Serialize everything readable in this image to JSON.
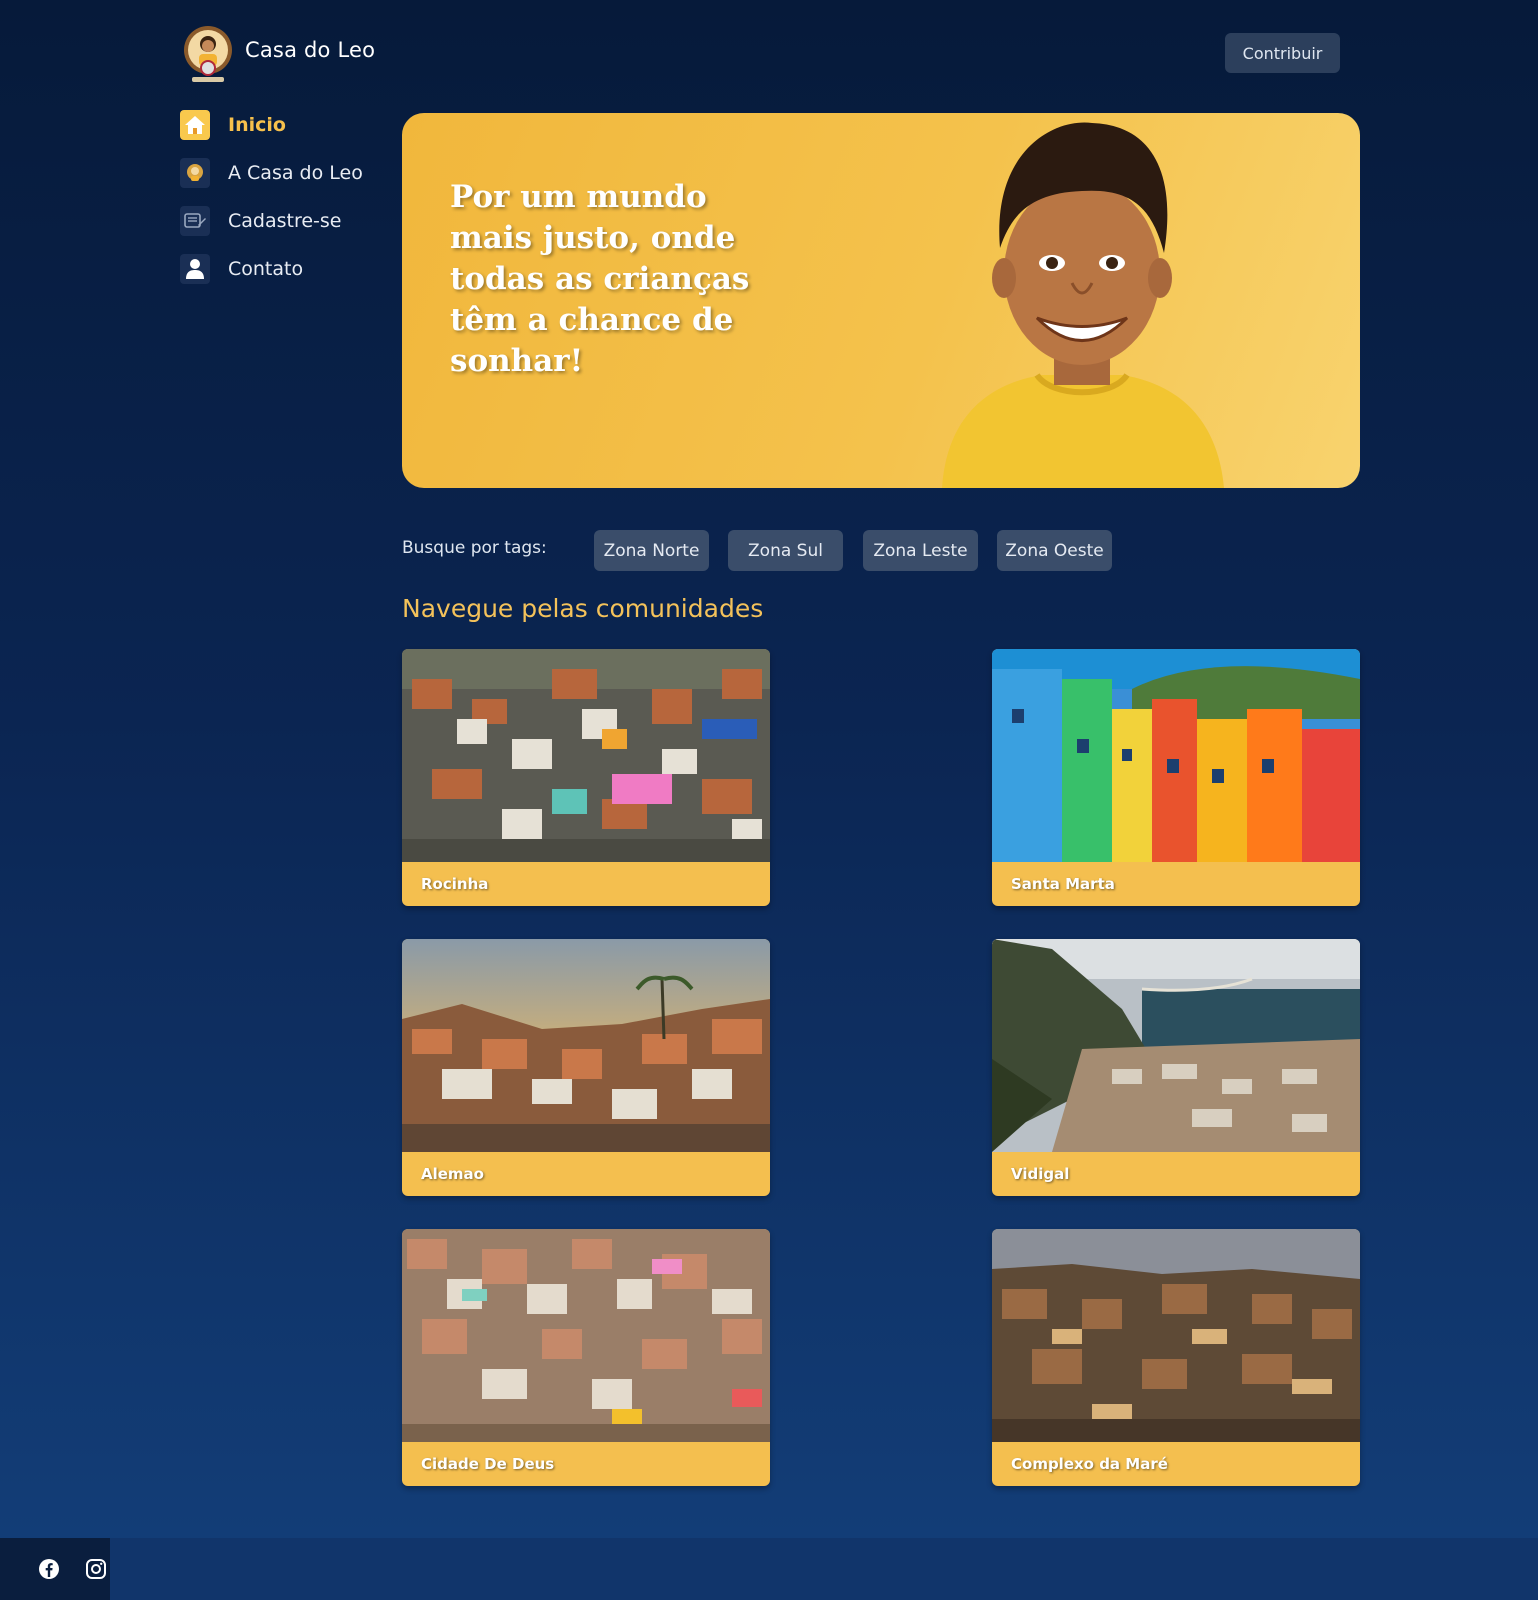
{
  "header": {
    "brand": "Casa do Leo",
    "contribute_label": "Contribuir"
  },
  "sidebar": {
    "items": [
      {
        "label": "Inicio",
        "icon": "home-icon",
        "active": true
      },
      {
        "label": "A Casa do Leo",
        "icon": "leo-logo-icon",
        "active": false
      },
      {
        "label": "Cadastre-se",
        "icon": "register-icon",
        "active": false
      },
      {
        "label": "Contato",
        "icon": "user-icon",
        "active": false
      }
    ]
  },
  "hero": {
    "headline": "Por um mundo mais justo, onde todas as crianças têm a chance de sonhar!"
  },
  "tags": {
    "label": "Busque por tags:",
    "items": [
      "Zona Norte",
      "Zona Sul",
      "Zona Leste",
      "Zona Oeste"
    ]
  },
  "communities": {
    "title": "Navegue pelas comunidades",
    "items": [
      {
        "name": "Rocinha"
      },
      {
        "name": "Santa Marta"
      },
      {
        "name": "Alemao"
      },
      {
        "name": "Vidigal"
      },
      {
        "name": "Cidade De Deus"
      },
      {
        "name": "Complexo da Maré"
      }
    ]
  },
  "footer": {
    "icons": [
      "facebook-icon",
      "instagram-icon"
    ]
  },
  "colors": {
    "accent": "#f4c25a",
    "card": "#f4bf4f",
    "background_top": "#061a3a",
    "background_bottom": "#133f7a"
  }
}
